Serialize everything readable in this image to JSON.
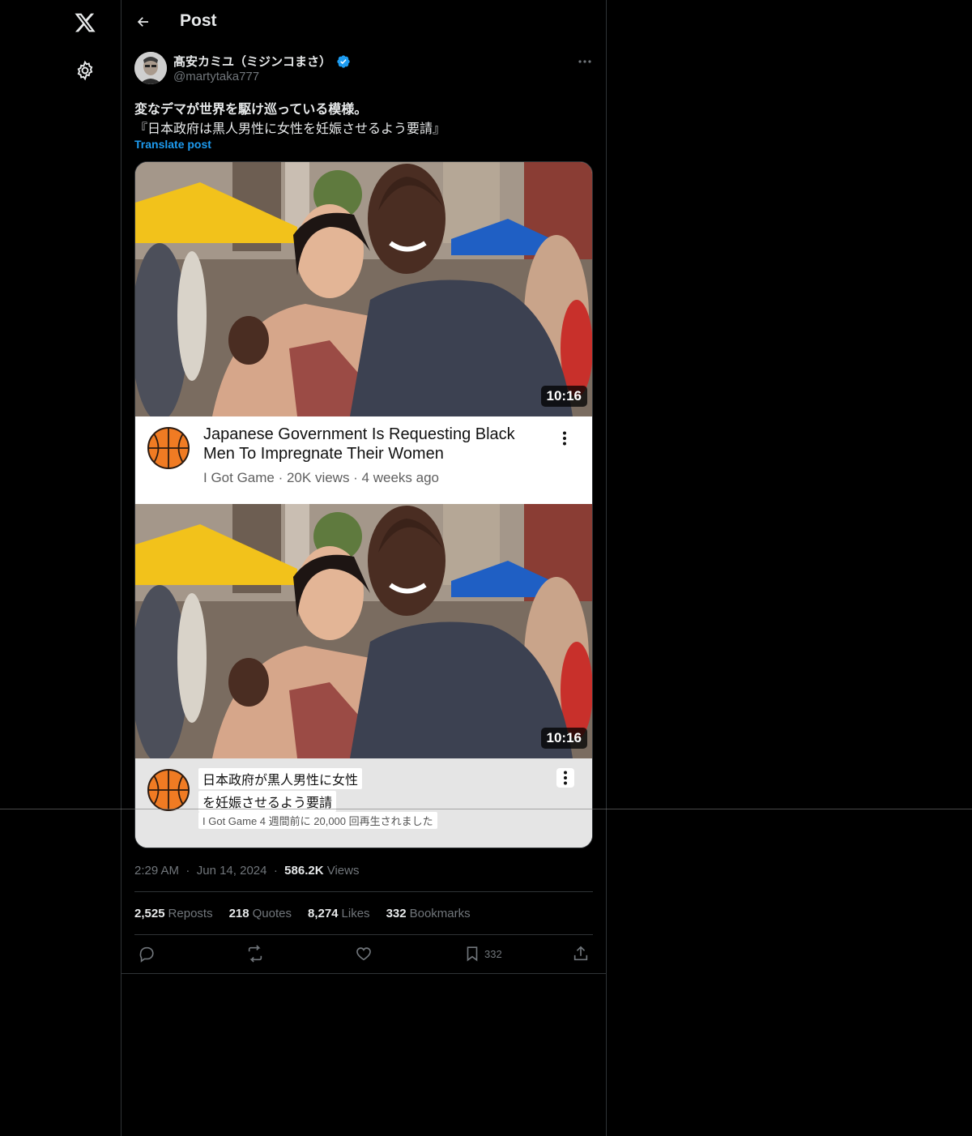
{
  "header": {
    "title": "Post"
  },
  "author": {
    "name": "髙安カミユ（ミジンコまさ）",
    "handle": "@martytaka777",
    "verified": true
  },
  "post": {
    "line1": "変なデマが世界を駆け巡っている模様。",
    "line2": "『日本政府は黒人男性に女性を妊娠させるよう要請』",
    "translate_label": "Translate post"
  },
  "media": {
    "video1": {
      "duration": "10:16",
      "title": "Japanese Government Is Requesting Black Men To Impregnate Their Women",
      "meta": "I Got Game · 20K views · 4 weeks ago"
    },
    "video2": {
      "duration": "10:16",
      "title_line1": "日本政府が黒人男性に女性",
      "title_line2": "を妊娠させるよう要請",
      "meta": "I Got Game 4 週間前に 20,000 回再生されました"
    }
  },
  "meta": {
    "time": "2:29 AM",
    "date": "Jun 14, 2024",
    "views_count": "586.2K",
    "views_label": "Views"
  },
  "stats": [
    {
      "count": "2,525",
      "label": "Reposts"
    },
    {
      "count": "218",
      "label": "Quotes"
    },
    {
      "count": "8,274",
      "label": "Likes"
    },
    {
      "count": "332",
      "label": "Bookmarks"
    }
  ],
  "actions": {
    "reply_icon": "reply-icon",
    "repost_icon": "repost-icon",
    "like_icon": "like-icon",
    "bookmark_icon": "bookmark-icon",
    "bookmark_count": "332",
    "share_icon": "share-icon"
  },
  "colors": {
    "background": "#000000",
    "accent": "#1d9bf0",
    "muted": "#71767b",
    "border": "#2f3336"
  }
}
